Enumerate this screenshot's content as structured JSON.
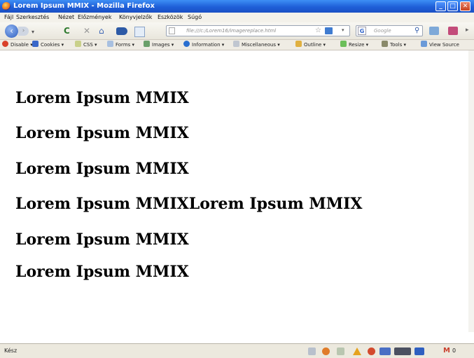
{
  "window": {
    "title": "Lorem Ipsum MMIX - Mozilla Firefox"
  },
  "menu": [
    "Fájl",
    "Szerkesztés",
    "Nézet",
    "Előzmények",
    "Könyvjelzők",
    "Eszközök",
    "Súgó"
  ],
  "navbar": {
    "url": "file:///c:/Lorem16/imagereplace.html",
    "search_placeholder": "Google"
  },
  "devtoolbar": {
    "items": [
      "Disable",
      "Cookies",
      "CSS",
      "Forms",
      "Images",
      "Information",
      "Miscellaneous",
      "Outline",
      "Resize",
      "Tools",
      "View Source"
    ]
  },
  "content": {
    "headings": [
      "Lorem Ipsum MMIX",
      "Lorem Ipsum MMIX",
      "Lorem Ipsum MMIX",
      "Lorem Ipsum MMIXLorem Ipsum MMIX",
      "Lorem Ipsum MMIX",
      "Lorem Ipsum MMIX"
    ]
  },
  "statusbar": {
    "text": "Kész",
    "mail_icon": "M",
    "mail_count": "0"
  }
}
